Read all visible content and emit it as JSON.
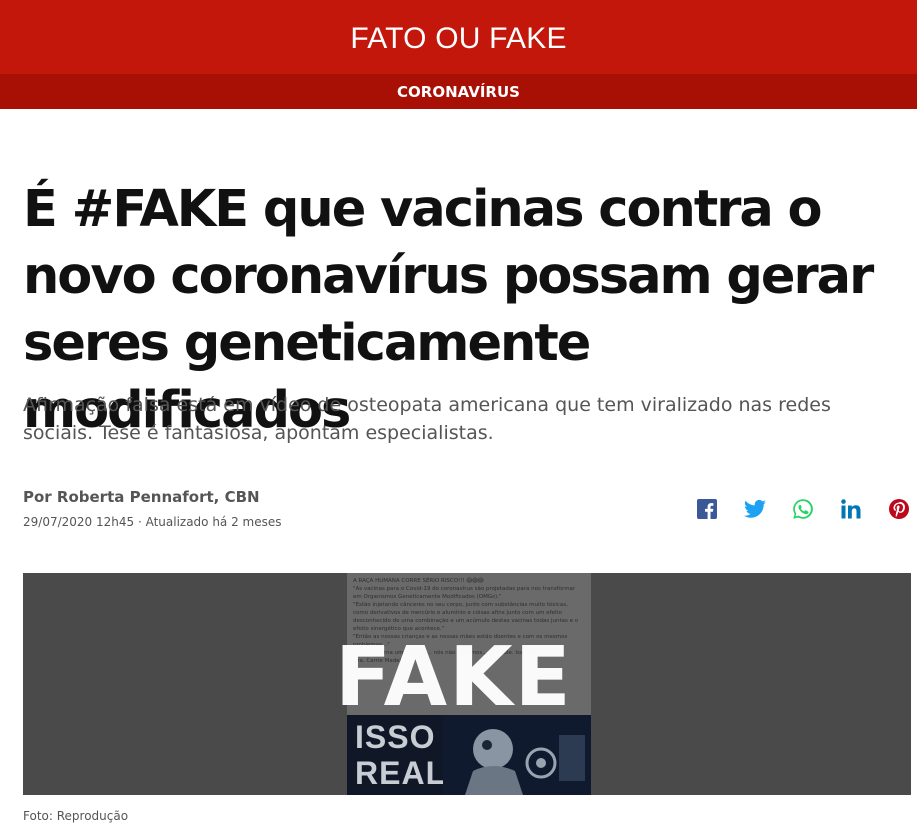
{
  "header": {
    "title": "FATO OU FAKE",
    "section": "CORONAVÍRUS"
  },
  "article": {
    "headline": "É #FAKE que vacinas contra o novo coronavírus possam gerar seres geneticamente modificados",
    "subtitle": "Afirmação falsa está em vídeo de osteopata americana que tem viralizado nas redes sociais. Tese é fantasiosa, apontam especialistas.",
    "byline": "Por Roberta Pennafort, CBN",
    "dateline": "29/07/2020 12h45 · Atualizado há 2 meses"
  },
  "share": {
    "icons": [
      "facebook-icon",
      "twitter-icon",
      "whatsapp-icon",
      "linkedin-icon",
      "pinterest-icon"
    ],
    "colors": {
      "facebook": "#3b5998",
      "twitter": "#1da1f2",
      "whatsapp": "#25d366",
      "linkedin": "#0077b5",
      "pinterest": "#bd081c"
    }
  },
  "media": {
    "stamp": "FAKE",
    "post_lines": [
      "A RAÇA HUMANA CORRE SÉRIO RISCO!!! 😱😱😱",
      "\"As vacinas para o Covid-19 do coronavírus são projetadas para nos transformar em Organismos Geneticamente Modificados (OMGs).\"",
      "\"Estão injetando cânceres no seu corpo, junto com substâncias muito tóxicas, como derivativos de mercúrio e alumínio e coisas afins junto com um efeito desconhecido de uma combinação e um acúmulo destas vacinas todas juntas e o efeito sinergético que acontece.\"",
      "\"Então as nossas crianças e as nossas mães estão doentes e com os mesmos problemas...\"",
      "\"Você se torna um produto... nós não podemos... controle. Isso não é...\"",
      "Dra. Carrie Madej"
    ],
    "poster_lines": [
      "ISSO É",
      "REAL"
    ],
    "caption": "Foto: Reprodução"
  },
  "colors": {
    "brand": "#c4170c",
    "brand_dark": "#a80f05",
    "text": "#111111",
    "muted": "#555555"
  }
}
